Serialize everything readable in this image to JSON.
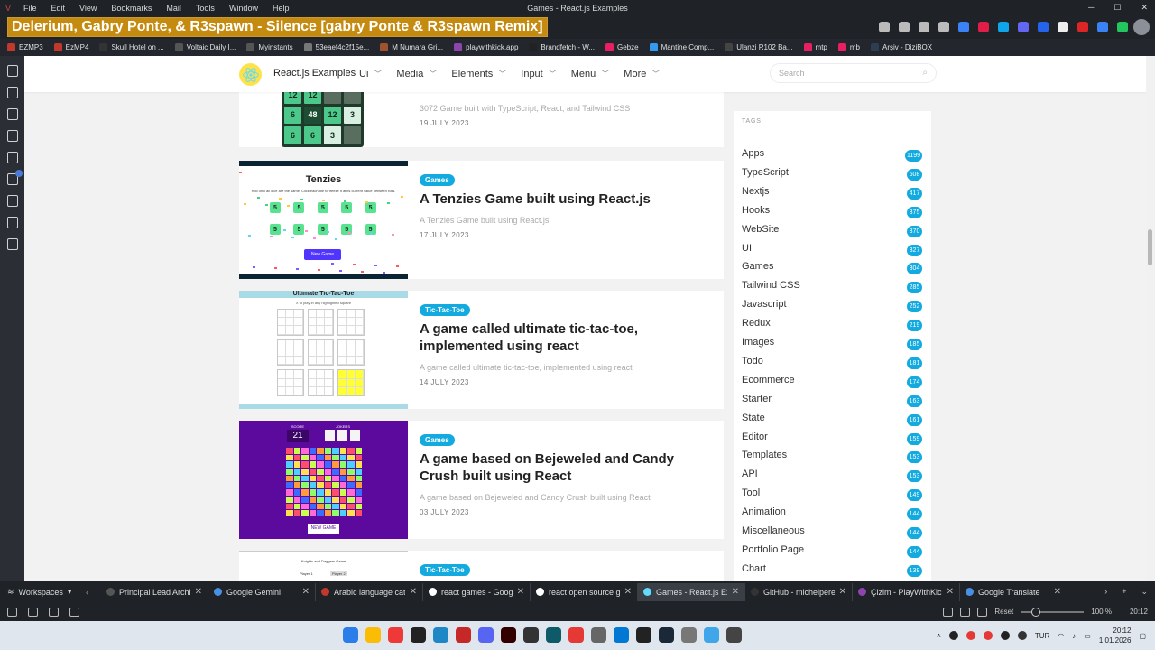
{
  "browser": {
    "menu": [
      "File",
      "Edit",
      "View",
      "Bookmarks",
      "Mail",
      "Tools",
      "Window",
      "Help"
    ],
    "window_title": "Games - React.js Examples",
    "now_playing": "Delerium, Gabry Ponte, & R3spawn - Silence [gabry Ponte & R3spawn Remix]",
    "bookmarks": [
      {
        "label": "EZMP3",
        "color": "#c0392b"
      },
      {
        "label": "EzMP4",
        "color": "#c0392b"
      },
      {
        "label": "Skull Hotel on ...",
        "color": "#333333"
      },
      {
        "label": "Voltaic Daily I...",
        "color": "#555555"
      },
      {
        "label": "Myinstants",
        "color": "#555555"
      },
      {
        "label": "53eaef4c2f15e...",
        "color": "#777777"
      },
      {
        "label": "M Numara Gri...",
        "color": "#a0522d"
      },
      {
        "label": "playwithkick.app",
        "color": "#8e44ad"
      },
      {
        "label": "Brandfetch - W...",
        "color": "#222222"
      },
      {
        "label": "Gebze",
        "color": "#e91e63"
      },
      {
        "label": "Mantine Comp...",
        "color": "#339af0"
      },
      {
        "label": "Ulanzi R102 Ba...",
        "color": "#444444"
      },
      {
        "label": "mtp",
        "color": "#e91e63"
      },
      {
        "label": "mb",
        "color": "#e91e63"
      },
      {
        "label": "Arşiv - DiziBOX",
        "color": "#2c3e50"
      }
    ]
  },
  "site": {
    "brand": "React.js Examples",
    "nav": [
      "Ui",
      "Media",
      "Elements",
      "Input",
      "Menu",
      "More"
    ],
    "search_placeholder": "Search"
  },
  "articles": [
    {
      "tag": "",
      "title": "",
      "desc": "3072 Game built with TypeScript, React, and Tailwind CSS",
      "date": "19 JULY 2023"
    },
    {
      "tag": "Games",
      "title": "A Tenzies Game built using React.js",
      "desc": "A Tenzies Game built using React.js",
      "date": "17 JULY 2023",
      "thumb": {
        "heading": "Tenzies",
        "sub": "Roll until all dice are the same. Click each die to freeze it at its current value between rolls.",
        "die": "5",
        "button": "New Game"
      }
    },
    {
      "tag": "Tic-Tac-Toe",
      "title": "A game called ultimate tic-tac-toe, implemented using react",
      "desc": "A game called ultimate tic-tac-toe, implemented using react",
      "date": "14 JULY 2023",
      "thumb": {
        "heading": "Ultimate Tic-Tac-Toe",
        "sub": "X to play in any highlighted square"
      }
    },
    {
      "tag": "Games",
      "title": "A game based on Bejeweled and Candy Crush built using React",
      "desc": "A game based on Bejeweled and Candy Crush built using React",
      "date": "03 JULY 2023",
      "thumb": {
        "score_label": "SCORE",
        "score": "21",
        "jokers_label": "JOKERS",
        "button": "NEW GAME"
      }
    },
    {
      "tag": "Tic-Tac-Toe",
      "title": "",
      "desc": "",
      "date": "",
      "thumb": {
        "heading": "Knights and Daggers Game",
        "player1": "Player 1",
        "player2": "Player 2"
      }
    }
  ],
  "game_3072": {
    "rows": [
      [
        "12",
        "12",
        "",
        ""
      ],
      [
        "6",
        "48",
        "12",
        "3"
      ],
      [
        "6",
        "6",
        "3",
        ""
      ]
    ]
  },
  "tags": {
    "heading": "TAGS",
    "items": [
      {
        "name": "Apps",
        "count": "1199"
      },
      {
        "name": "TypeScript",
        "count": "608"
      },
      {
        "name": "Nextjs",
        "count": "417"
      },
      {
        "name": "Hooks",
        "count": "375"
      },
      {
        "name": "WebSite",
        "count": "370"
      },
      {
        "name": "UI",
        "count": "327"
      },
      {
        "name": "Games",
        "count": "304"
      },
      {
        "name": "Tailwind CSS",
        "count": "285"
      },
      {
        "name": "Javascript",
        "count": "252"
      },
      {
        "name": "Redux",
        "count": "219"
      },
      {
        "name": "Images",
        "count": "185"
      },
      {
        "name": "Todo",
        "count": "181"
      },
      {
        "name": "Ecommerce",
        "count": "174"
      },
      {
        "name": "Starter",
        "count": "163"
      },
      {
        "name": "State",
        "count": "161"
      },
      {
        "name": "Editor",
        "count": "159"
      },
      {
        "name": "Templates",
        "count": "153"
      },
      {
        "name": "API",
        "count": "153"
      },
      {
        "name": "Tool",
        "count": "149"
      },
      {
        "name": "Animation",
        "count": "144"
      },
      {
        "name": "Miscellaneous",
        "count": "144"
      },
      {
        "name": "Portfolio Page",
        "count": "144"
      },
      {
        "name": "Chart",
        "count": "139"
      }
    ]
  },
  "tabbar": {
    "workspaces": "Workspaces",
    "tabs": [
      {
        "label": "Principal Lead Architec",
        "color": "#555555",
        "active": false
      },
      {
        "label": "Google Gemini",
        "color": "#4a90e2",
        "active": false
      },
      {
        "label": "Arabic language categ",
        "color": "#c0392b",
        "active": false
      },
      {
        "label": "react games - Google \\",
        "color": "#ffffff",
        "active": false
      },
      {
        "label": "react open source gam",
        "color": "#ffffff",
        "active": false
      },
      {
        "label": "Games - React.js Exam",
        "color": "#61dafb",
        "active": true
      },
      {
        "label": "GitHub - michelpereira",
        "color": "#333333",
        "active": false
      },
      {
        "label": "Çizim - PlayWithKick.A",
        "color": "#8e44ad",
        "active": false
      },
      {
        "label": "Google Translate",
        "color": "#4a90e2",
        "active": false
      }
    ]
  },
  "statusbar": {
    "reset": "Reset",
    "zoom": "100 %",
    "time": "20:12"
  },
  "taskbar": {
    "lang": "TUR",
    "time": "20:12",
    "date": "1.01.2026"
  }
}
